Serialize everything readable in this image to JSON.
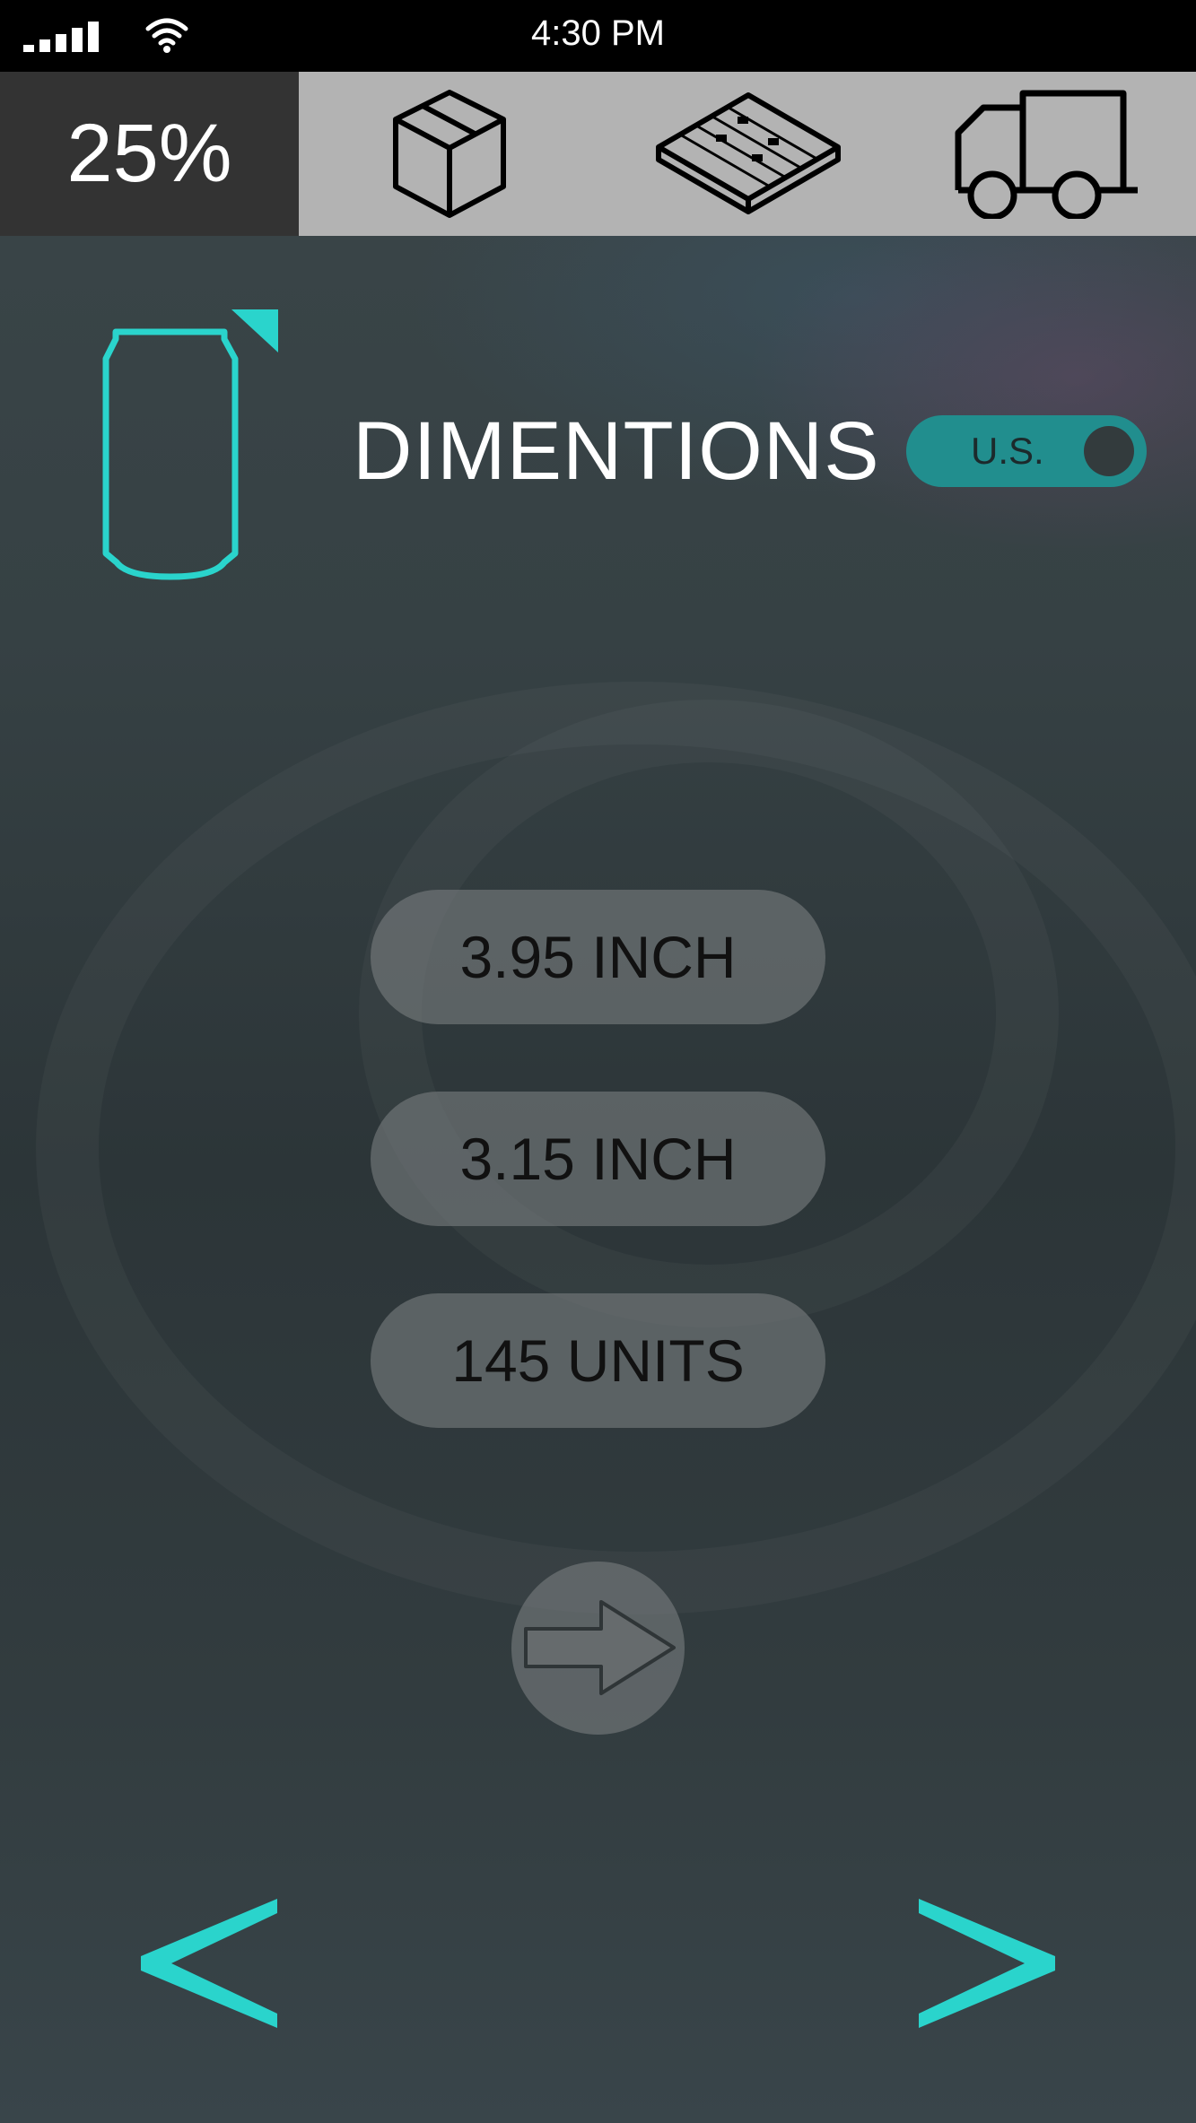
{
  "status_bar": {
    "time": "4:30 PM",
    "signal_icon": "signal-bars-icon",
    "wifi_icon": "wifi-icon"
  },
  "top_nav": {
    "progress": "25%",
    "progress_fraction": 0.25,
    "steps": [
      {
        "icon": "box-icon"
      },
      {
        "icon": "pallet-icon"
      },
      {
        "icon": "truck-icon"
      }
    ]
  },
  "header": {
    "product_icon": "can-icon",
    "title": "DIMENTIONS",
    "unit_toggle": {
      "label": "U.S."
    }
  },
  "fields": {
    "height": "3.95 INCH",
    "diameter": "3.15 INCH",
    "units": "145 UNITS"
  },
  "actions": {
    "next_icon": "arrow-right-icon",
    "prev_page_icon": "chevron-left-icon",
    "next_page_icon": "chevron-right-icon"
  },
  "colors": {
    "accent": "#2ad4cc",
    "toggle": "#218e8e",
    "status_bar": "#000000",
    "nav_bar": "#b3b3b3",
    "progress_cell": "#333333"
  }
}
